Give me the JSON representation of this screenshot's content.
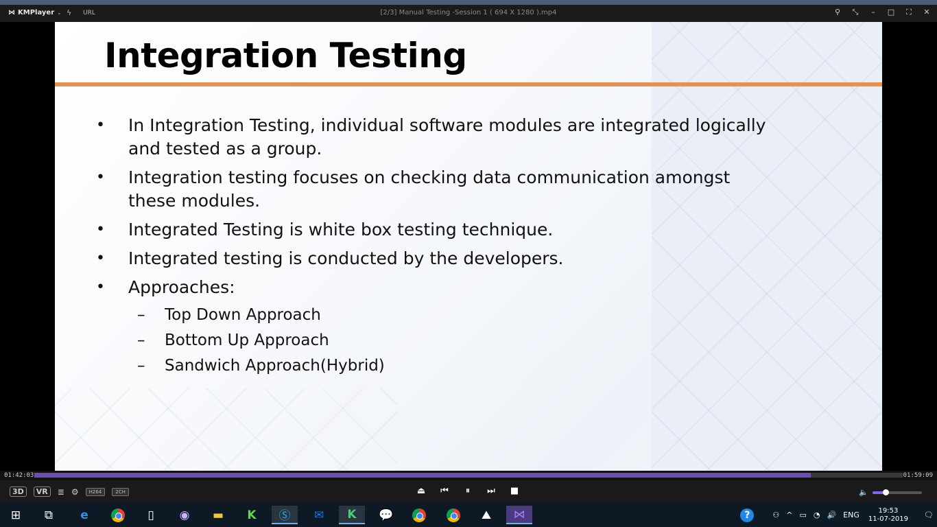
{
  "player": {
    "brand": "KMPlayer",
    "url_label": "URL",
    "window_title": "[2/3] Manual Testing -Session 1 ( 694 X 1280 ).mp4",
    "elapsed": "01:42:03",
    "duration": "01:59:09",
    "progress_fraction": 0.8945,
    "volume_fraction": 0.27,
    "badges": {
      "three_d": "3D",
      "vr": "VR",
      "codec": "H264",
      "channels": "2CH"
    },
    "accent_color": "#6a4fb0"
  },
  "slide": {
    "title": "Integration Testing",
    "rule_color": "#e8904f",
    "bullets": [
      " In Integration Testing, individual software modules are integrated logically and tested as a group.",
      " Integration testing focuses on checking data communication amongst these modules.",
      " Integrated Testing is white box testing technique.",
      " Integrated testing is conducted by the developers.",
      "Approaches:"
    ],
    "sub_items": [
      "Top Down Approach",
      "Bottom Up Approach",
      "Sandwich Approach(Hybrid)"
    ],
    "bullet_glyph": "•",
    "dash_glyph": "–"
  },
  "taskbar": {
    "tray_language": "ENG",
    "time": "19:53",
    "date": "11-07-2019"
  }
}
